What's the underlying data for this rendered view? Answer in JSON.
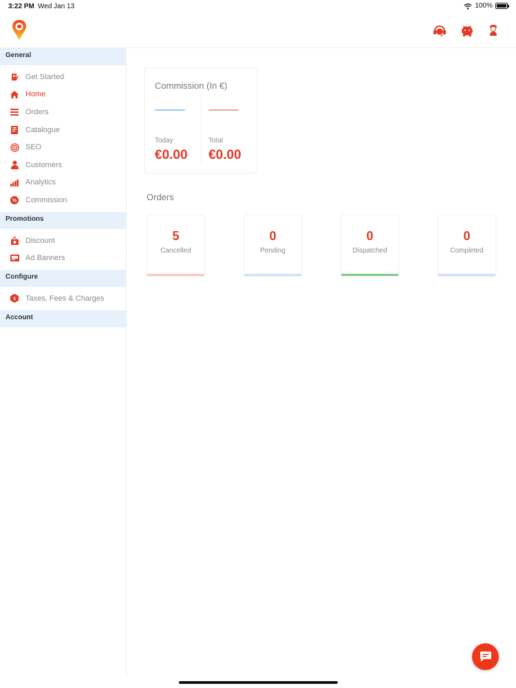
{
  "status_bar": {
    "time": "3:22 PM",
    "date": "Wed Jan 13",
    "battery": "100%"
  },
  "colors": {
    "accent": "#e03b24",
    "section_bg": "#e7f1fb",
    "cancelled": "#f7c9c6",
    "pending": "#cfe0fb",
    "dispatched": "#7cc98a",
    "completed": "#d3dcf8",
    "today_line": "#9cc7f2",
    "total_line": "#f2a3a0"
  },
  "sidebar": {
    "general": {
      "title": "General",
      "items": [
        {
          "label": "Get Started",
          "icon": "document-edit-icon"
        },
        {
          "label": "Home",
          "icon": "home-icon"
        },
        {
          "label": "Orders",
          "icon": "orders-list-icon"
        },
        {
          "label": "Catalogue",
          "icon": "book-icon"
        },
        {
          "label": "SEO",
          "icon": "target-icon"
        },
        {
          "label": "Customers",
          "icon": "person-icon"
        },
        {
          "label": "Analytics",
          "icon": "bar-chart-icon"
        },
        {
          "label": "Commission",
          "icon": "percent-badge-icon"
        }
      ]
    },
    "promotions": {
      "title": "Promotions",
      "items": [
        {
          "label": "Discount",
          "icon": "discount-tag-icon"
        },
        {
          "label": "Ad Banners",
          "icon": "banner-icon"
        }
      ]
    },
    "configure": {
      "title": "Configure",
      "items": [
        {
          "label": "Taxes, Fees & Charges",
          "icon": "tax-hexagon-icon"
        }
      ]
    },
    "account": {
      "title": "Account"
    }
  },
  "commission": {
    "title": "Commission (In €)",
    "today": {
      "label": "Today",
      "value": "€0.00"
    },
    "total": {
      "label": "Total",
      "value": "€0.00"
    }
  },
  "orders": {
    "title": "Orders",
    "cards": [
      {
        "count": "5",
        "status": "Cancelled"
      },
      {
        "count": "0",
        "status": "Pending"
      },
      {
        "count": "0",
        "status": "Dispatched"
      },
      {
        "count": "0",
        "status": "Completed"
      }
    ]
  }
}
